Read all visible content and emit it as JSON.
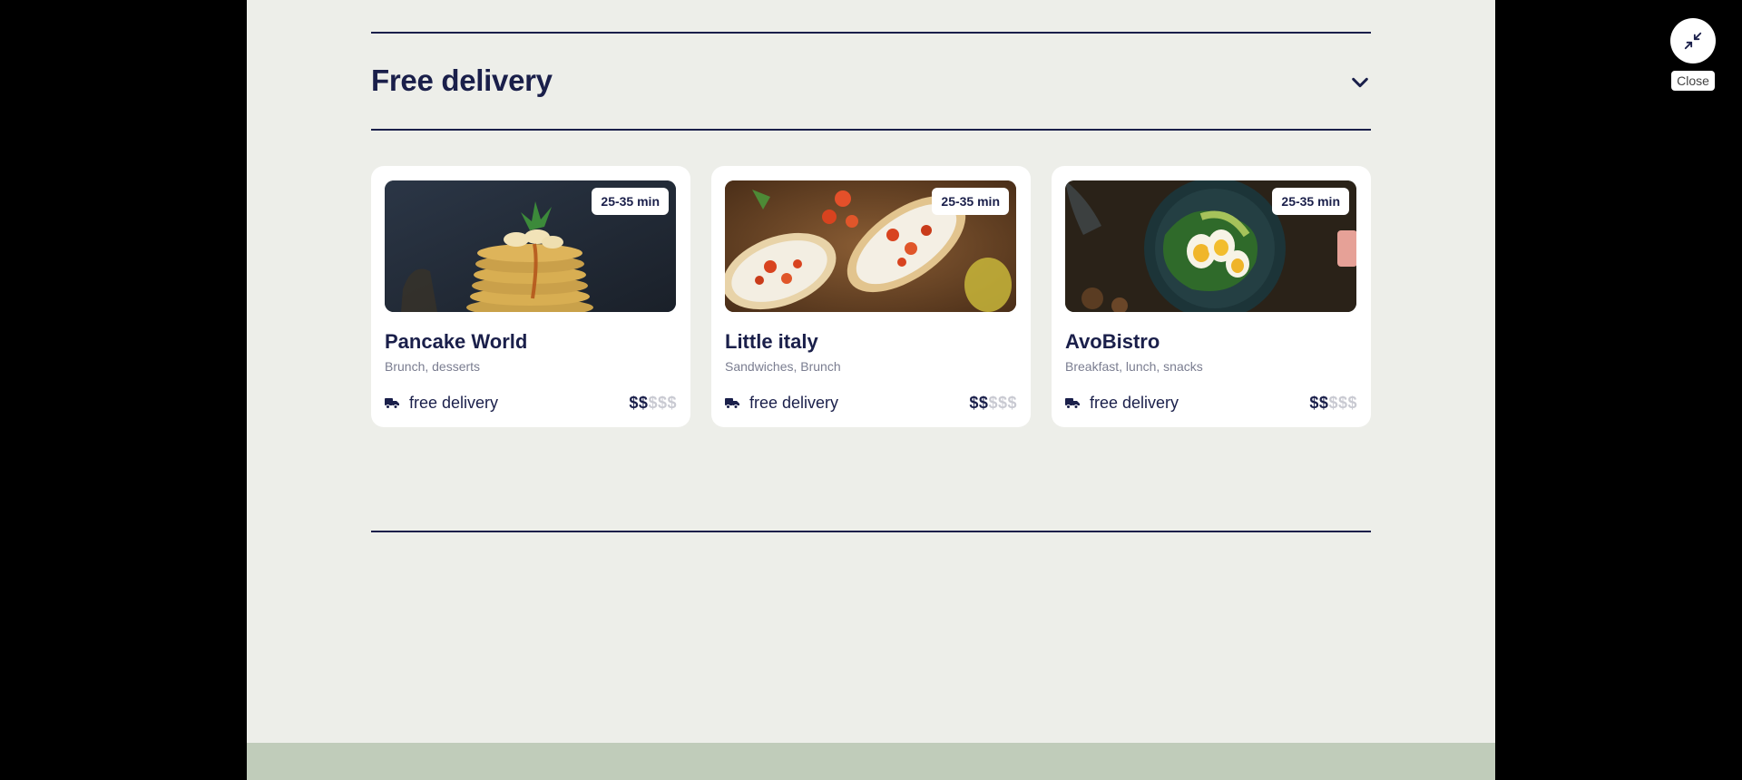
{
  "section": {
    "title": "Free delivery"
  },
  "cards": [
    {
      "name": "Pancake World",
      "tags": "Brunch, desserts",
      "time": "25-35 min",
      "delivery": "free delivery",
      "price_active": "$$",
      "price_inactive": "$$$"
    },
    {
      "name": "Little italy",
      "tags": "Sandwiches, Brunch",
      "time": "25-35 min",
      "delivery": "free delivery",
      "price_active": "$$",
      "price_inactive": "$$$"
    },
    {
      "name": "AvoBistro",
      "tags": "Breakfast, lunch, snacks",
      "time": "25-35 min",
      "delivery": "free delivery",
      "price_active": "$$",
      "price_inactive": "$$$"
    }
  ],
  "close": {
    "label": "Close"
  },
  "colors": {
    "navy": "#1a1f4a",
    "page_bg": "#edeee9",
    "footer_band": "#c0ccba"
  }
}
